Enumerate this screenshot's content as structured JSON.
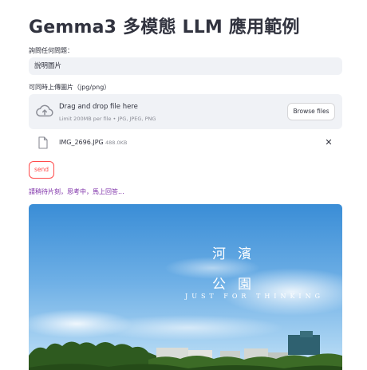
{
  "app": {
    "title": "Gemma3 多模態 LLM 應用範例"
  },
  "question": {
    "label": "詢問任何問題：",
    "value": "說明圖片"
  },
  "uploader": {
    "label": "可同時上傳圖片（jpg/png）",
    "drop_text": "Drag and drop file here",
    "limit_text": "Limit 200MB per file • JPG, JPEG, PNG",
    "browse_label": "Browse files",
    "file": {
      "name": "IMG_2696.JPG",
      "size": "488.0KB"
    }
  },
  "send_button": {
    "label": "send"
  },
  "status_text": "請稍待片刻，思考中，馬上回答...",
  "image_watermark": {
    "char1": "河",
    "char2": "濱",
    "char3": "公",
    "char4": "園",
    "subtitle": "JUST FOR THINKING"
  },
  "icons": {
    "upload": "cloud-upload-icon",
    "file": "file-icon",
    "close": "close-icon"
  },
  "colors": {
    "accent": "#ff4b4b",
    "status": "#7d2ea8",
    "input_bg": "#f0f2f6"
  }
}
